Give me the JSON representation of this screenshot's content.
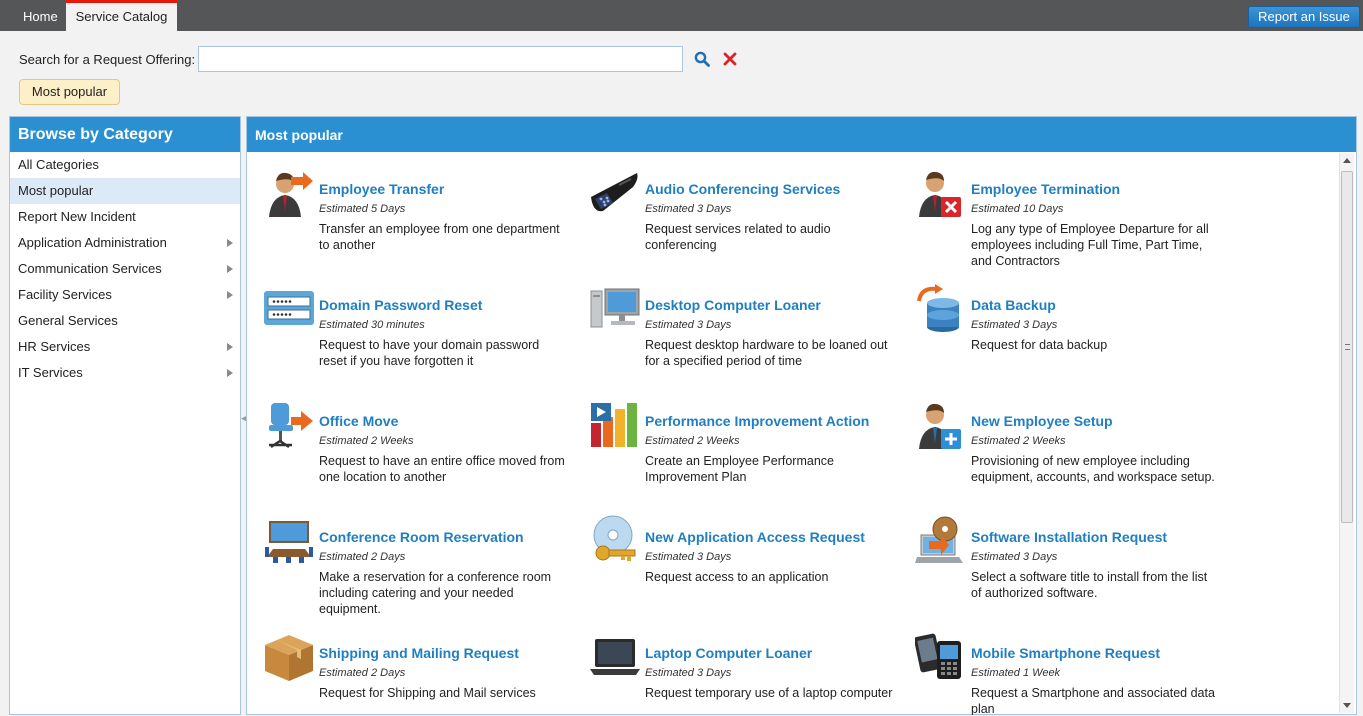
{
  "topbar": {
    "tabs": [
      {
        "label": "Home"
      },
      {
        "label": "Service Catalog"
      }
    ],
    "report_button": "Report an Issue"
  },
  "search": {
    "label": "Search for a Request Offering:",
    "value": "",
    "placeholder": ""
  },
  "filter_pill": "Most popular",
  "sidebar": {
    "title": "Browse by Category",
    "items": [
      {
        "label": "All Categories"
      },
      {
        "label": "Most popular"
      },
      {
        "label": "Report New Incident"
      },
      {
        "label": "Application Administration"
      },
      {
        "label": "Communication Services"
      },
      {
        "label": "Facility Services"
      },
      {
        "label": "General Services"
      },
      {
        "label": "HR Services"
      },
      {
        "label": "IT Services"
      }
    ]
  },
  "main": {
    "title": "Most popular",
    "offerings": [
      {
        "title": "Employee Transfer",
        "estimate": "Estimated 5 Days",
        "description": "Transfer an employee from one department to another",
        "icon": "person-arrow-icon"
      },
      {
        "title": "Audio Conferencing Services",
        "estimate": "Estimated 3 Days",
        "description": "Request services related to audio conferencing",
        "icon": "conference-phone-icon"
      },
      {
        "title": "Employee Termination",
        "estimate": "Estimated 10 Days",
        "description": "Log any type of Employee Departure for all employees including Full Time, Part Time, and Contractors",
        "icon": "person-remove-icon"
      },
      {
        "title": "Domain Password Reset",
        "estimate": "Estimated 30 minutes",
        "description": "Request to have your domain password reset if you have forgotten it",
        "icon": "password-field-icon"
      },
      {
        "title": "Desktop Computer Loaner",
        "estimate": "Estimated 3 Days",
        "description": "Request desktop hardware to be loaned out for a specified period of time",
        "icon": "desktop-computer-icon"
      },
      {
        "title": "Data Backup",
        "estimate": "Estimated 3 Days",
        "description": "Request for data backup",
        "icon": "database-backup-icon"
      },
      {
        "title": "Office Move",
        "estimate": "Estimated 2 Weeks",
        "description": "Request to have an entire office moved from one location to another",
        "icon": "office-chair-icon"
      },
      {
        "title": "Performance Improvement Action",
        "estimate": "Estimated 2 Weeks",
        "description": "Create an Employee Performance Improvement Plan",
        "icon": "bar-chart-icon"
      },
      {
        "title": "New Employee Setup",
        "estimate": "Estimated 2 Weeks",
        "description": "Provisioning of new employee including equipment, accounts, and workspace setup.",
        "icon": "person-add-icon"
      },
      {
        "title": "Conference Room Reservation",
        "estimate": "Estimated 2 Days",
        "description": "Make a reservation for a conference room including catering and your needed equipment.",
        "icon": "conference-room-icon"
      },
      {
        "title": "New Application Access Request",
        "estimate": "Estimated 3 Days",
        "description": "Request access to an application",
        "icon": "disc-key-icon"
      },
      {
        "title": "Software Installation Request",
        "estimate": "Estimated 3 Days",
        "description": "Select a software title to install from the list of authorized software.",
        "icon": "software-install-icon"
      },
      {
        "title": "Shipping and Mailing Request",
        "estimate": "Estimated 2 Days",
        "description": "Request for Shipping and Mail services",
        "icon": "package-box-icon"
      },
      {
        "title": "Laptop Computer Loaner",
        "estimate": "Estimated 3 Days",
        "description": "Request temporary use of a laptop computer",
        "icon": "laptop-icon"
      },
      {
        "title": "Mobile Smartphone Request",
        "estimate": "Estimated 1 Week",
        "description": "Request a Smartphone and associated data plan",
        "icon": "smartphone-icon"
      }
    ]
  },
  "colors": {
    "header_blue": "#2a90d2",
    "title_blue": "#1f7fc0",
    "topbar_gray": "#555658",
    "active_tab_accent": "#e8170b"
  }
}
